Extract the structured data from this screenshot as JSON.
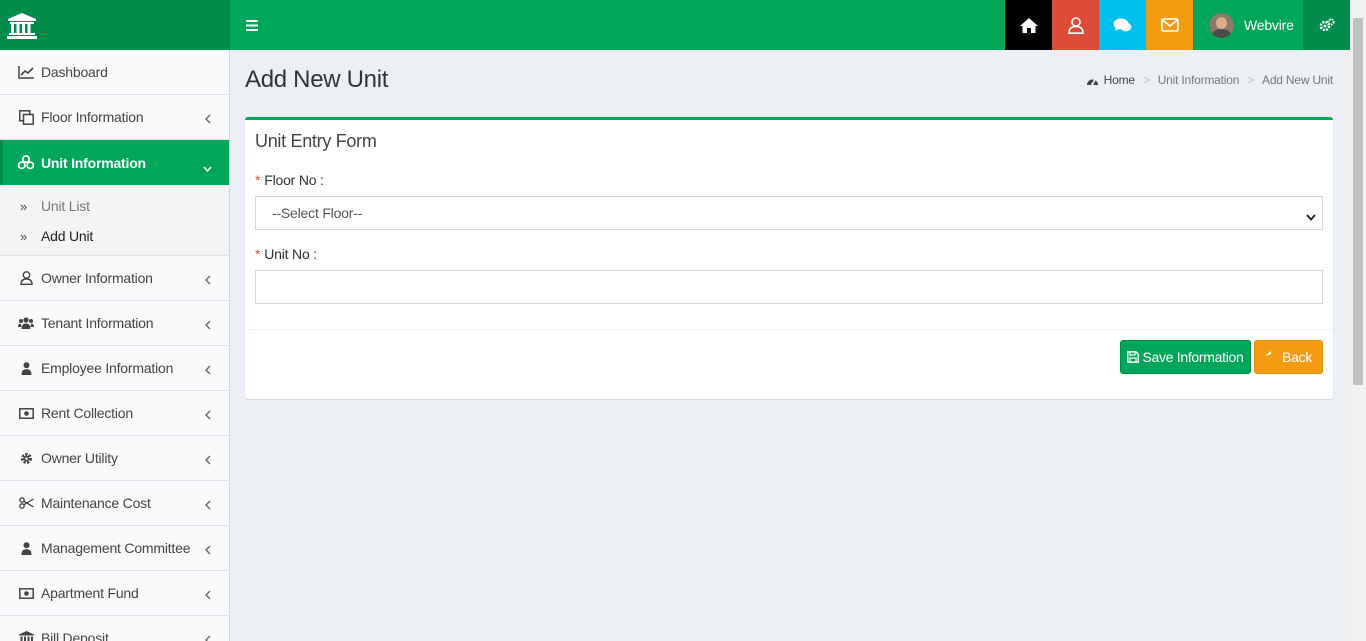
{
  "header": {
    "logo_icon": "institution-icon",
    "menu_toggle_icon": "bars-icon",
    "buttons": [
      {
        "name": "home-button",
        "icon": "home-icon",
        "color": "#000000"
      },
      {
        "name": "profile-button",
        "icon": "user-icon",
        "color": "#dd4b39"
      },
      {
        "name": "messages-button",
        "icon": "comments-icon",
        "color": "#00c0ef"
      },
      {
        "name": "mail-button",
        "icon": "envelope-icon",
        "color": "#f39c12"
      }
    ],
    "user_name": "Webvire",
    "settings_icon": "gears-icon"
  },
  "sidebar": {
    "items": [
      {
        "label": "Dashboard",
        "icon": "line-chart-icon"
      },
      {
        "label": "Floor Information",
        "icon": "clone-icon"
      },
      {
        "label": "Unit Information",
        "icon": "cubes-icon",
        "active": true,
        "children": [
          {
            "label": "Unit List"
          },
          {
            "label": "Add Unit",
            "current": true
          }
        ]
      },
      {
        "label": "Owner Information",
        "icon": "user-outline-icon"
      },
      {
        "label": "Tenant Information",
        "icon": "users-icon"
      },
      {
        "label": "Employee Information",
        "icon": "user-icon"
      },
      {
        "label": "Rent Collection",
        "icon": "money-icon"
      },
      {
        "label": "Owner Utility",
        "icon": "cog-icon"
      },
      {
        "label": "Maintenance Cost",
        "icon": "scissors-icon"
      },
      {
        "label": "Management Committee",
        "icon": "user-icon"
      },
      {
        "label": "Apartment Fund",
        "icon": "money-icon"
      },
      {
        "label": "Bill Deposit",
        "icon": "bank-icon"
      }
    ]
  },
  "main": {
    "page_title": "Add New Unit",
    "breadcrumb": [
      "Home",
      "Unit Information",
      "Add New Unit"
    ],
    "form": {
      "title": "Unit Entry Form",
      "floor_label": "Floor No :",
      "floor_select_value": "--Select Floor--",
      "unit_label": "Unit No :",
      "unit_value": "",
      "required_marker": "*",
      "save_label": "Save Information",
      "back_label": "Back"
    }
  },
  "colors": {
    "brand_green": "#00a65a",
    "brand_green_dark": "#008d4c",
    "back_orange": "#f39c12",
    "required_red": "#dd4b39"
  }
}
